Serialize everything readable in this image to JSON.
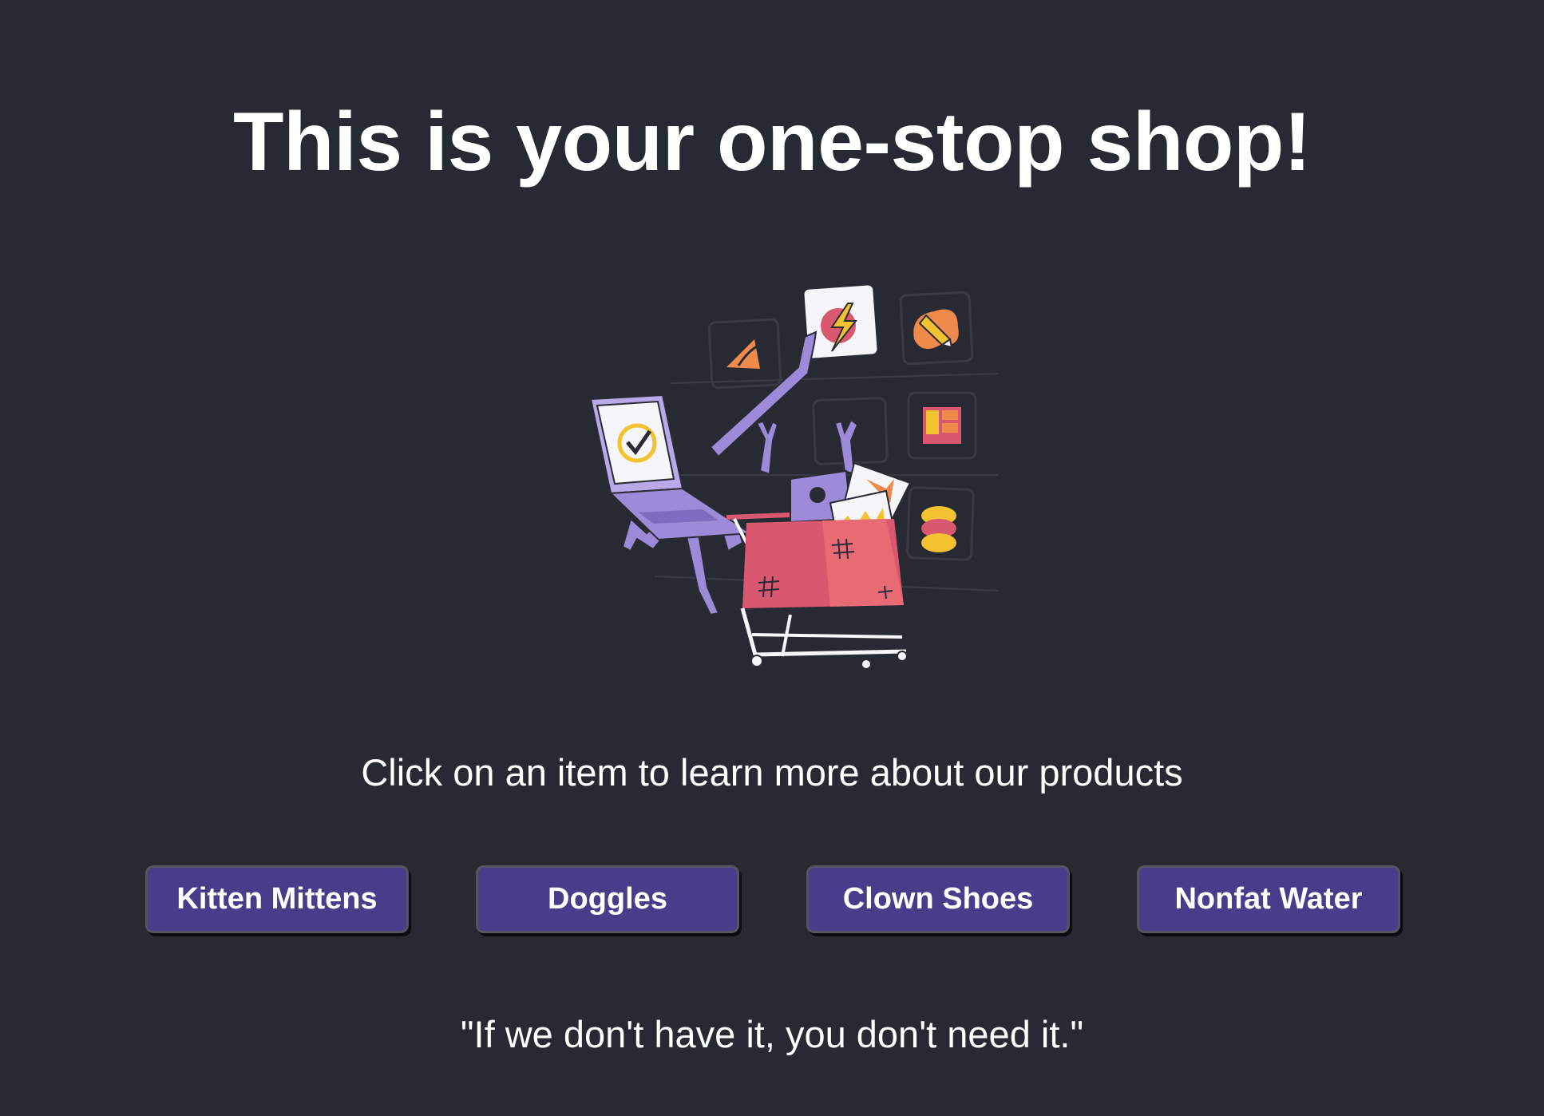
{
  "header": {
    "title": "This is your one-stop shop!"
  },
  "hero": {
    "illustration": "shopping-cart-illustration"
  },
  "main": {
    "instruction": "Click on an item to learn more about our products",
    "products": [
      {
        "label": "Kitten Mittens"
      },
      {
        "label": "Doggles"
      },
      {
        "label": "Clown Shoes"
      },
      {
        "label": "Nonfat Water"
      }
    ]
  },
  "footer": {
    "tagline": "\"If we don't have it, you don't need it.\""
  },
  "colors": {
    "background": "#282a33",
    "button": "#483d8b",
    "text": "#ffffff",
    "accent_purple": "#9b8bd8",
    "accent_red": "#d9576f",
    "accent_yellow": "#f2c230",
    "accent_orange": "#f08a4b"
  }
}
